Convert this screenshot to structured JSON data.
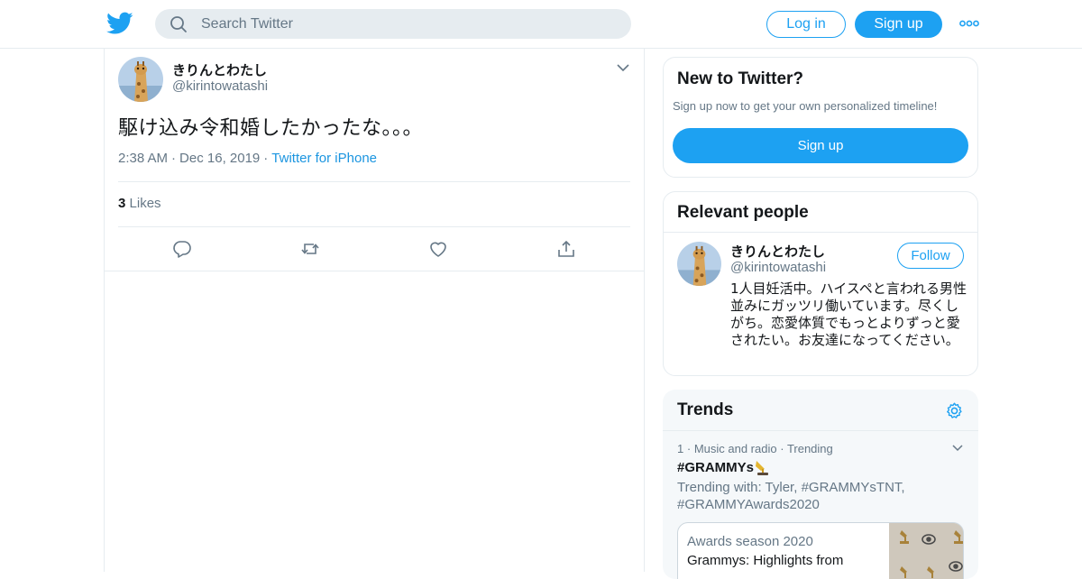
{
  "header": {
    "search_placeholder": "Search Twitter",
    "login_label": "Log in",
    "signup_label": "Sign up",
    "brand_color": "#1da1f2"
  },
  "tweet": {
    "name": "きりんとわたし",
    "handle": "@kirintowatashi",
    "text": "駆け込み令和婚したかったな。。。",
    "time": "2:38 AM",
    "date": "Dec 16, 2019",
    "source": "Twitter for iPhone",
    "likes_count": "3",
    "likes_label": "Likes",
    "actions": [
      "reply-icon",
      "retweet-icon",
      "like-icon",
      "share-icon"
    ]
  },
  "sidebar": {
    "new_to_twitter": {
      "title": "New to Twitter?",
      "subtitle": "Sign up now to get your own personalized timeline!",
      "button": "Sign up"
    },
    "relevant_people": {
      "title": "Relevant people",
      "name": "きりんとわたし",
      "handle": "@kirintowatashi",
      "follow_label": "Follow",
      "bio": "1人目妊活中。ハイスペと言われる男性並みにガッツリ働いています。尽くしがち。恋愛体質でもっとよりずっと愛されたい。お友達になってください。"
    },
    "trends": {
      "title": "Trends",
      "item": {
        "rank": "1",
        "category": "Music and radio",
        "status": "Trending",
        "tag": "#GRAMMYs",
        "trending_with": "Trending with: Tyler, #GRAMMYsTNT, #GRAMMYAwards2020",
        "story_category": "Awards season 2020",
        "story_title": "Grammys: Highlights from"
      }
    }
  }
}
